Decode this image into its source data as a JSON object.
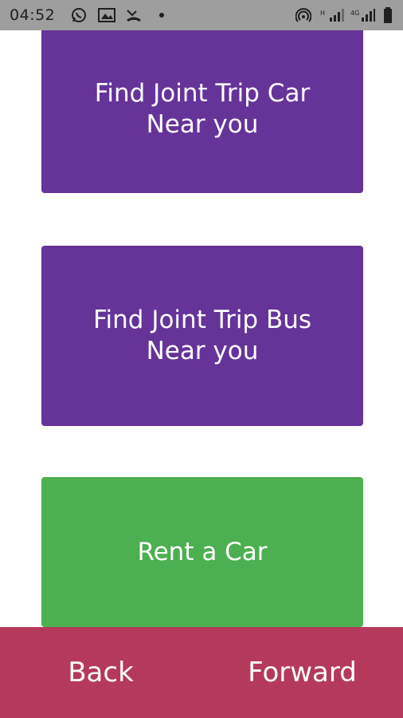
{
  "status_bar": {
    "time": "04:52",
    "icons": [
      "whatsapp-icon",
      "gallery-icon",
      "missed-call-icon",
      "dot-icon",
      "hotspot-icon",
      "signal-icon",
      "signal-icon-2",
      "battery-icon"
    ]
  },
  "tiles": {
    "car": {
      "label": "Find Joint Trip Car\nNear you",
      "color": "#663399"
    },
    "bus": {
      "label": "Find Joint Trip Bus\nNear you",
      "color": "#663399"
    },
    "rent": {
      "label": "Rent a Car",
      "color": "#4caf50"
    }
  },
  "bottom_nav": {
    "background": "#b5395a",
    "back_label": "Back",
    "forward_label": "Forward"
  }
}
